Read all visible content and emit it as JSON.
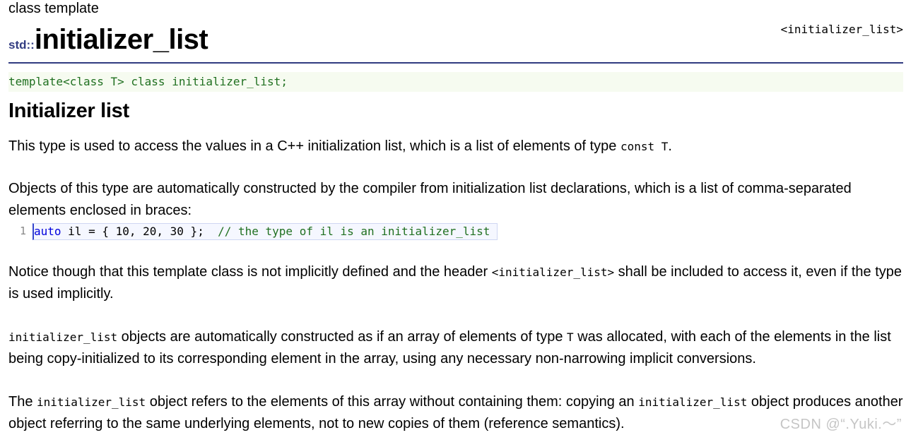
{
  "header": {
    "kind": "class template",
    "namespace": "std::",
    "name": "initializer_list",
    "header_link": "<initializer_list>"
  },
  "declaration": "template<class T> class initializer_list;",
  "section_title": "Initializer list",
  "paragraphs": {
    "p1": {
      "text_a": "This type is used to access the values in a C++ initialization list, which is a list of elements of type ",
      "code_a": "const T",
      "text_b": "."
    },
    "p2": {
      "text": "Objects of this type are automatically constructed by the compiler from initialization list declarations, which is a list of comma-separated elements enclosed in braces:"
    },
    "p3": {
      "text_a": "Notice though that this template class is not implicitly defined and the header ",
      "code_a": "<initializer_list>",
      "text_b": " shall be included to access it, even if the type is used implicitly."
    },
    "p4": {
      "code_a": "initializer_list",
      "text_a": " objects are automatically constructed as if an array of elements of type ",
      "code_b": "T",
      "text_b": " was allocated, with each of the elements in the list being copy-initialized to its corresponding element in the array, using any necessary non-narrowing implicit conversions."
    },
    "p5": {
      "text_a": "The ",
      "code_a": "initializer_list",
      "text_b": " object refers to the elements of this array without containing them: copying an ",
      "code_b": "initializer_list",
      "text_c": " object produces another object referring to the same underlying elements, not to new copies of them (reference semantics)."
    }
  },
  "example": {
    "line_number": "1",
    "keyword": "auto",
    "code": " il = { 10, 20, 30 };  ",
    "comment": "// the type of il is an initializer_list"
  },
  "watermark": "CSDN @“.Yuki.～”"
}
